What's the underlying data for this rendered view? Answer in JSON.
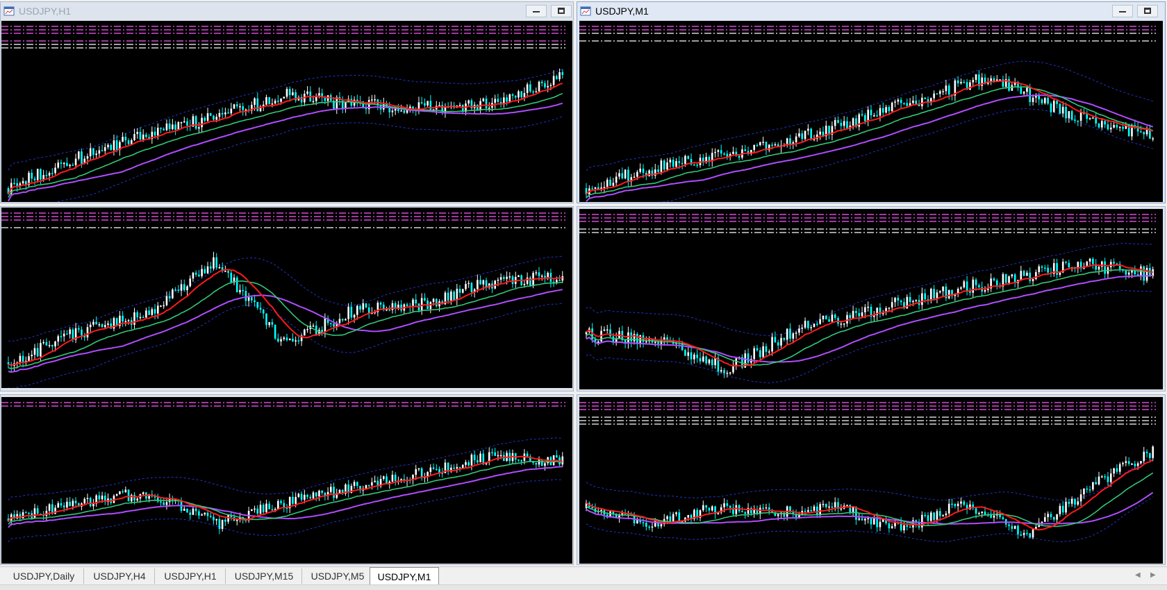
{
  "windows": [
    {
      "title": "USDJPY,H1",
      "active": false,
      "seed": 11,
      "trend": [
        0,
        0.25,
        0.45,
        0.6,
        0.78,
        0.7,
        0.68,
        0.72,
        0.95
      ],
      "lines": [
        "#ff5bff",
        "#ff5bff",
        "#ff5bff",
        "#ff5bff",
        "#ffffff",
        "#ffffff"
      ]
    },
    {
      "title": "USDJPY,M1",
      "active": true,
      "seed": 23,
      "trend": [
        0,
        0.2,
        0.3,
        0.5,
        0.72,
        0.95,
        0.6,
        0.45
      ],
      "lines": [
        "#ff5bff",
        "#ff5bff",
        "#ffffff",
        "#ffffff"
      ]
    },
    {
      "title": "",
      "active": false,
      "seed": 37,
      "trend": [
        0.1,
        0.35,
        0.5,
        0.95,
        0.25,
        0.55,
        0.6,
        0.78,
        0.82
      ],
      "lines": [
        "#ff5bff",
        "#ff5bff",
        "#ff5bff",
        "#ffffff"
      ]
    },
    {
      "title": "",
      "active": false,
      "seed": 51,
      "trend": [
        0.35,
        0.3,
        0.05,
        0.4,
        0.55,
        0.7,
        0.82,
        0.95,
        0.85
      ],
      "lines": [
        "#ff5bff",
        "#ff5bff",
        "#ff5bff",
        "#ffffff",
        "#ffffff"
      ]
    },
    {
      "title": "",
      "active": false,
      "seed": 67,
      "trend": [
        0.3,
        0.45,
        0.55,
        0.25,
        0.45,
        0.6,
        0.75,
        0.9,
        0.85
      ],
      "lines": [
        "#ff5bff",
        "#ff5bff"
      ]
    },
    {
      "title": "",
      "active": false,
      "seed": 83,
      "trend": [
        0.4,
        0.25,
        0.4,
        0.35,
        0.4,
        0.2,
        0.45,
        0.15,
        0.6,
        0.95
      ],
      "lines": [
        "#ff5bff",
        "#ff5bff",
        "#ff5bff",
        "#ffffff",
        "#ffffff",
        "#ffffff"
      ]
    }
  ],
  "tabs": [
    {
      "label": "USDJPY,Daily"
    },
    {
      "label": "USDJPY,H4"
    },
    {
      "label": "USDJPY,H1"
    },
    {
      "label": "USDJPY,M15"
    },
    {
      "label": "USDJPY,M5"
    },
    {
      "label": "USDJPY,M1"
    }
  ],
  "active_tab": "USDJPY,M1",
  "colors": {
    "bull": "#ffffff",
    "bear": "#00ffff",
    "ma_fast": "#ff1a1a",
    "ma_mid": "#33c77a",
    "ma_slow": "#b04dff",
    "band": "#2233cc"
  }
}
